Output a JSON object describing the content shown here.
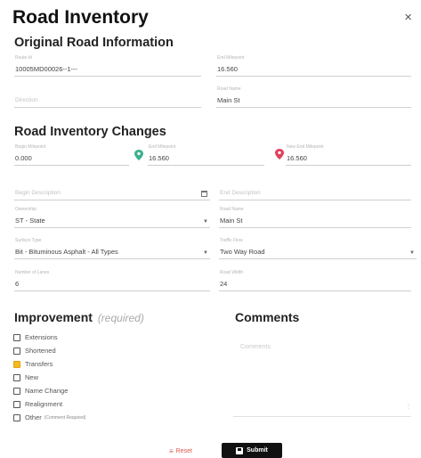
{
  "dialog": {
    "title": "Road Inventory",
    "close_glyph": "×"
  },
  "original": {
    "heading": "Original Road Information",
    "route_label": "Route Id",
    "route_value": "10005MD00026--1---",
    "end_label": "End Milepoint",
    "end_value": "16.560",
    "direction_label": "Direction",
    "road_name_label": "Road Name",
    "road_name_value": "Main St"
  },
  "changes": {
    "heading": "Road Inventory Changes",
    "begin_mp_label": "Begin Milepoint",
    "begin_mp_value": "0.000",
    "end_mp_label": "End Milepoint",
    "end_mp_value": "16.560",
    "new_end_label": "New End Milepoint",
    "new_end_value": "16.560",
    "begin_desc_placeholder": "Begin Description",
    "end_desc_placeholder": "End Description",
    "ownership_label": "Ownership",
    "ownership_value": "ST - State",
    "road_name_label": "Road Name",
    "road_name_value": "Main St",
    "surface_label": "Surface Type",
    "surface_value": "Bit - Bituminous Asphalt - All Types",
    "traffic_label": "Traffic Flow",
    "traffic_value": "Two Way Road",
    "lanes_label": "Number of Lanes",
    "lanes_value": "6",
    "width_label": "Road Width",
    "width_value": "24"
  },
  "improvement": {
    "heading": "Improvement",
    "required": "(required)",
    "options": [
      {
        "label": "Extensions",
        "checked": false,
        "note": ""
      },
      {
        "label": "Shortened",
        "checked": false,
        "note": ""
      },
      {
        "label": "Transfers",
        "checked": true,
        "note": ""
      },
      {
        "label": "New",
        "checked": false,
        "note": ""
      },
      {
        "label": "Name Change",
        "checked": false,
        "note": ""
      },
      {
        "label": "Realignment",
        "checked": false,
        "note": ""
      },
      {
        "label": "Other",
        "checked": false,
        "note": "(Comment Required)"
      }
    ]
  },
  "comments": {
    "heading": "Comments",
    "placeholder": "Comments"
  },
  "actions": {
    "reset_label": "Reset",
    "submit_label": "Submit"
  },
  "colors": {
    "checkbox_on": "#f5b921",
    "begin_pin": "#3bb08f",
    "end_pin": "#e0405c",
    "reset": "#e0574c",
    "submit_bg": "#111111"
  }
}
